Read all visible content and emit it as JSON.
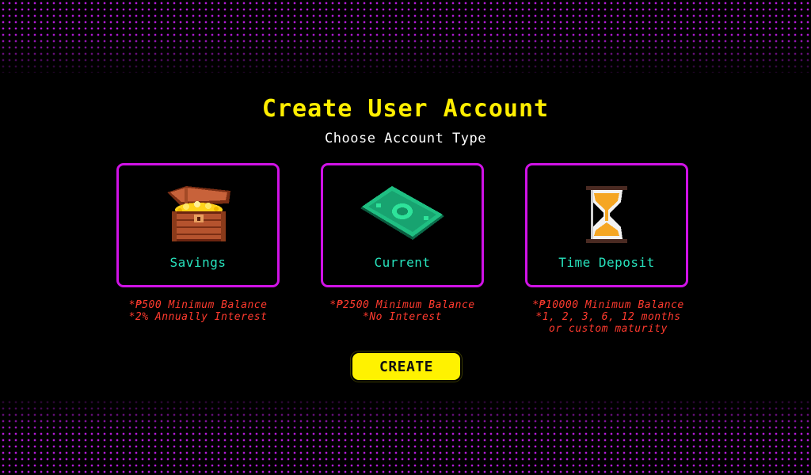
{
  "header": {
    "title": "Create User Account",
    "subtitle": "Choose Account Type"
  },
  "account_types": [
    {
      "label": "Savings",
      "icon": "treasure-chest-icon",
      "notes": [
        "*₱500 Minimum Balance",
        "*2% Annually Interest"
      ]
    },
    {
      "label": "Current",
      "icon": "cash-bill-icon",
      "notes": [
        "*₱2500 Minimum Balance",
        "*No Interest"
      ]
    },
    {
      "label": "Time Deposit",
      "icon": "hourglass-icon",
      "notes": [
        "*₱10000 Minimum Balance",
        "*1, 2, 3, 6, 12 months",
        "or custom maturity"
      ]
    }
  ],
  "actions": {
    "create_label": "CREATE"
  },
  "colors": {
    "background": "#000000",
    "title": "#ffee00",
    "card_border": "#d012e6",
    "card_label": "#27e3bd",
    "note": "#ff3a2e",
    "button": "#fff200",
    "dots": "#b21ad6"
  }
}
